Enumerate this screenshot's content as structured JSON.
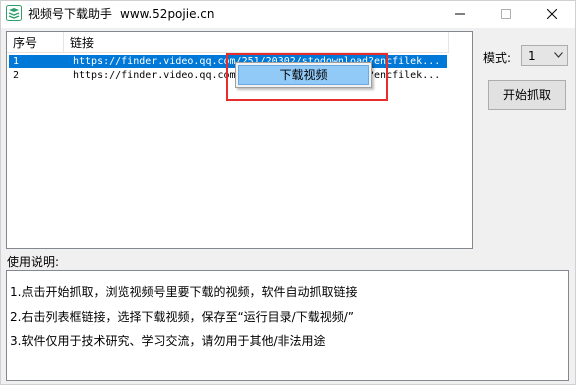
{
  "window": {
    "title": "视频号下载助手",
    "title_url": "www.52pojie.cn"
  },
  "listview": {
    "columns": [
      "序号",
      "链接"
    ],
    "rows": [
      {
        "no": "1",
        "link": "https://finder.video.qq.com/251/20302/stodownload?encfilek...",
        "selected": true
      },
      {
        "no": "2",
        "link": "https://finder.video.qq.com/251/20302/stodownload?encfilek...",
        "selected": false
      }
    ]
  },
  "context_menu": {
    "items": [
      "下载视频"
    ]
  },
  "mode": {
    "label": "模式:",
    "selected": "1"
  },
  "start_button": "开始抓取",
  "usage": {
    "label": "使用说明:",
    "lines": [
      "1.点击开始抓取，浏览视频号里要下载的视频，软件自动抓取链接",
      "2.右击列表框链接，选择下载视频，保存至“运行目录/下载视频/”",
      "3.软件仅用于技术研究、学习交流，请勿用于其他/非法用途"
    ]
  },
  "colors": {
    "selection": "#0078d7",
    "highlight_box": "#e82b2b",
    "menu_hover": "#91c9f7"
  }
}
